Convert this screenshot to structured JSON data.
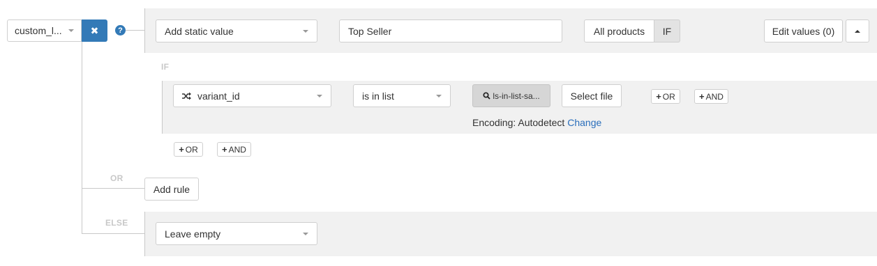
{
  "colors": {
    "accent": "#337ab7",
    "band": "#f1f1f1",
    "link": "#2a6ebb",
    "tag_text": "#c8c8c8"
  },
  "rule": {
    "column_select": {
      "label": "custom_l..."
    },
    "remove_icon": "close-icon",
    "help_icon": "question-circle-icon",
    "value_type": "Add static value",
    "value_text": "Top Seller",
    "scope_toggle": {
      "all_products": "All products",
      "if": "IF"
    },
    "edit_values": "Edit values (0)",
    "collapse_icon": "caret-up-icon"
  },
  "condition": {
    "if_label": "IF",
    "field": {
      "icon": "shuffle-icon",
      "label": "variant_id"
    },
    "operator": "is in list",
    "file_button": {
      "icon": "search-icon",
      "label": "ls-in-list-sa..."
    },
    "select_file": "Select file",
    "or_inline": "OR",
    "and_inline": "AND",
    "encoding_label": "Encoding: Autodetect",
    "encoding_change": "Change"
  },
  "group_actions": {
    "or": "OR",
    "and": "AND"
  },
  "or_section": {
    "label": "OR",
    "add_rule": "Add rule"
  },
  "else_section": {
    "label": "ELSE",
    "value": "Leave empty"
  }
}
